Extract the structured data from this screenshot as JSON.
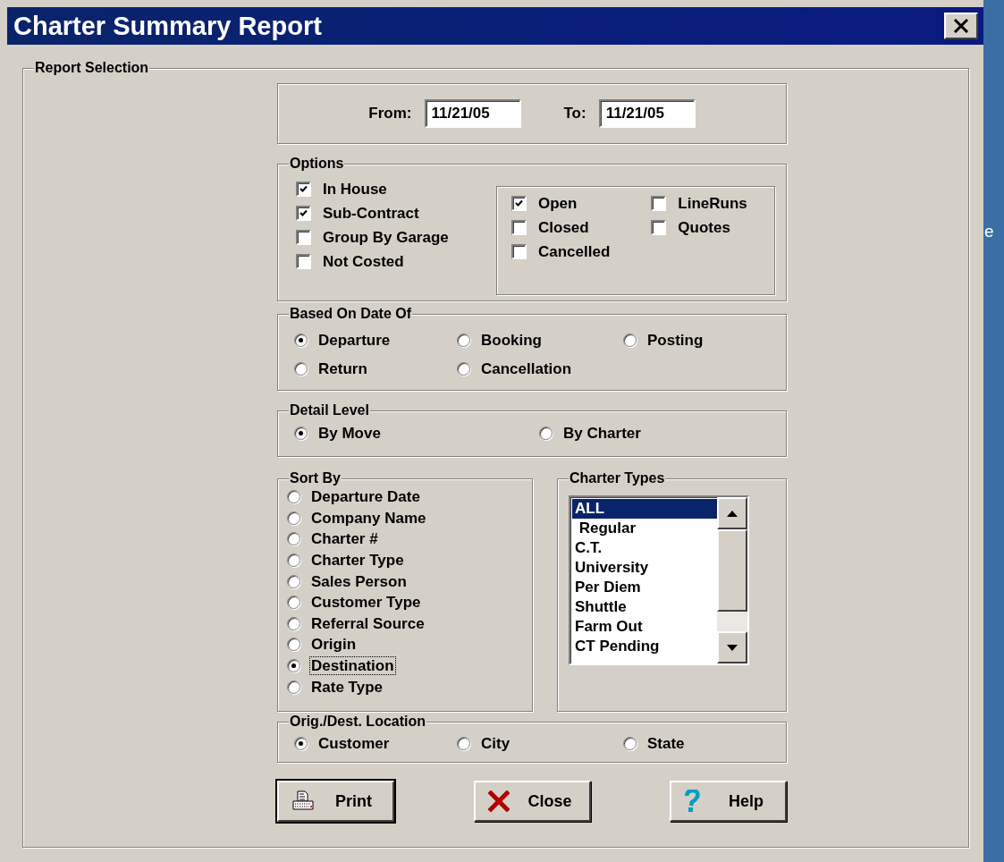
{
  "window": {
    "title": "Charter Summary Report"
  },
  "report_selection": {
    "title": "Report Selection",
    "date_range": {
      "from_label": "From:",
      "from_value": "11/21/05",
      "to_label": "To:",
      "to_value": "11/21/05"
    },
    "options": {
      "title": "Options",
      "left": [
        {
          "label": "In House",
          "checked": true
        },
        {
          "label": "Sub-Contract",
          "checked": true
        },
        {
          "label": "Group By Garage",
          "checked": false
        },
        {
          "label": "Not Costed",
          "checked": false
        }
      ],
      "status_columns": [
        [
          {
            "label": "Open",
            "checked": true
          },
          {
            "label": "Closed",
            "checked": false
          },
          {
            "label": "Cancelled",
            "checked": false
          }
        ],
        [
          {
            "label": "LineRuns",
            "checked": false
          },
          {
            "label": "Quotes",
            "checked": false
          }
        ]
      ]
    },
    "based_on_date_of": {
      "title": "Based On Date Of",
      "options": [
        {
          "label": "Departure",
          "selected": true
        },
        {
          "label": "Booking",
          "selected": false
        },
        {
          "label": "Posting",
          "selected": false
        },
        {
          "label": "Return",
          "selected": false
        },
        {
          "label": "Cancellation",
          "selected": false
        }
      ]
    },
    "detail_level": {
      "title": "Detail Level",
      "options": [
        {
          "label": "By Move",
          "selected": true
        },
        {
          "label": "By Charter",
          "selected": false
        }
      ]
    },
    "sort_by": {
      "title": "Sort By",
      "options": [
        {
          "label": "Departure Date",
          "selected": false,
          "focused": false
        },
        {
          "label": "Company Name",
          "selected": false,
          "focused": false
        },
        {
          "label": "Charter #",
          "selected": false,
          "focused": false
        },
        {
          "label": "Charter Type",
          "selected": false,
          "focused": false
        },
        {
          "label": "Sales Person",
          "selected": false,
          "focused": false
        },
        {
          "label": "Customer Type",
          "selected": false,
          "focused": false
        },
        {
          "label": "Referral Source",
          "selected": false,
          "focused": false
        },
        {
          "label": "Origin",
          "selected": false,
          "focused": false
        },
        {
          "label": "Destination",
          "selected": true,
          "focused": true
        },
        {
          "label": "Rate Type",
          "selected": false,
          "focused": false
        }
      ]
    },
    "charter_types": {
      "title": "Charter Types",
      "items": [
        {
          "label": "ALL",
          "selected": true
        },
        {
          "label": " Regular",
          "selected": false
        },
        {
          "label": "C.T.",
          "selected": false
        },
        {
          "label": "University",
          "selected": false
        },
        {
          "label": "Per Diem",
          "selected": false
        },
        {
          "label": "Shuttle",
          "selected": false
        },
        {
          "label": "Farm Out",
          "selected": false
        },
        {
          "label": "CT Pending",
          "selected": false
        }
      ]
    },
    "orig_dest_location": {
      "title": "Orig./Dest. Location",
      "options": [
        {
          "label": "Customer",
          "selected": true
        },
        {
          "label": "City",
          "selected": false
        },
        {
          "label": "State",
          "selected": false
        }
      ]
    },
    "buttons": [
      {
        "kind": "print",
        "label": "Print"
      },
      {
        "kind": "close",
        "label": "Close"
      },
      {
        "kind": "help",
        "label": "Help"
      }
    ]
  },
  "desktop": {
    "partial_text": [
      "e"
    ]
  }
}
